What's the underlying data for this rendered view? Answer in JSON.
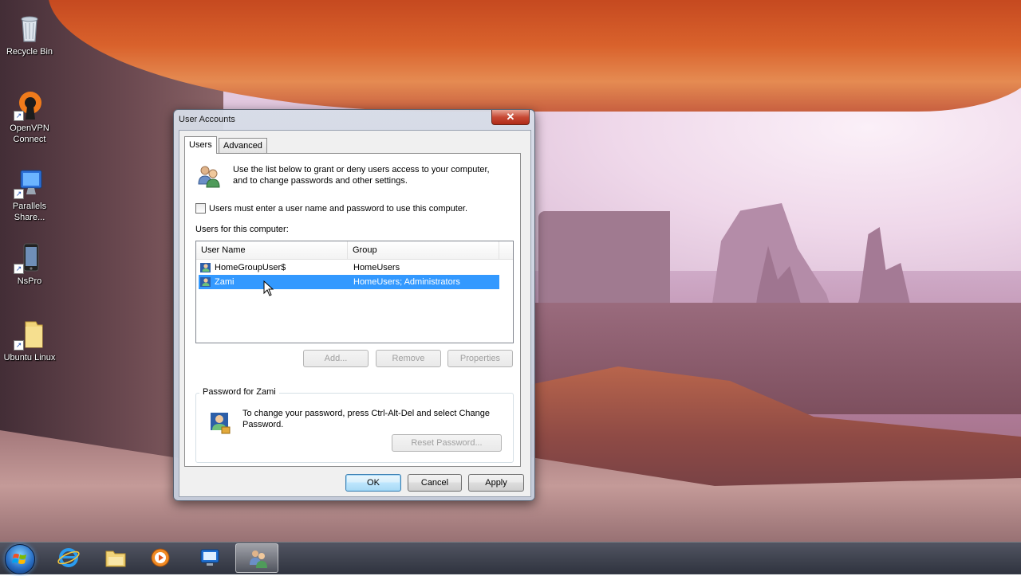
{
  "desktop": {
    "icons": [
      {
        "label": "Recycle Bin",
        "icon": "recycle-bin-icon"
      },
      {
        "label": "OpenVPN Connect",
        "icon": "openvpn-icon"
      },
      {
        "label": "Parallels Share...",
        "icon": "parallels-share-icon"
      },
      {
        "label": "NsPro",
        "icon": "nspro-icon"
      },
      {
        "label": "Ubuntu Linux",
        "icon": "folder-icon"
      }
    ]
  },
  "dialog": {
    "title": "User Accounts",
    "close_label": "✕",
    "tabs": [
      {
        "label": "Users",
        "selected": true
      },
      {
        "label": "Advanced",
        "selected": false
      }
    ],
    "intro_text": "Use the list below to grant or deny users access to your computer, and to change passwords and other settings.",
    "require_login": {
      "label": "Users must enter a user name and password to use this computer.",
      "checked": false
    },
    "users_label": "Users for this computer:",
    "columns": [
      "User Name",
      "Group"
    ],
    "users": [
      {
        "name": "HomeGroupUser$",
        "group": "HomeUsers",
        "selected": false
      },
      {
        "name": "Zami",
        "group": "HomeUsers; Administrators",
        "selected": true
      }
    ],
    "list_buttons": {
      "add": "Add...",
      "remove": "Remove",
      "properties": "Properties"
    },
    "password_group": {
      "title": "Password for Zami",
      "text": "To change your password, press Ctrl-Alt-Del and select Change Password.",
      "reset_label": "Reset Password..."
    },
    "footer": {
      "ok": "OK",
      "cancel": "Cancel",
      "apply": "Apply"
    }
  },
  "taskbar": {
    "items": [
      "start-orb",
      "internet-explorer-icon",
      "file-explorer-icon",
      "media-player-icon",
      "remote-desktop-icon",
      "user-accounts-icon"
    ],
    "active_item": "user-accounts-icon"
  }
}
